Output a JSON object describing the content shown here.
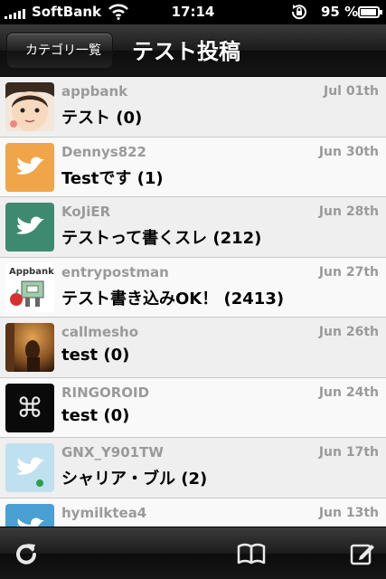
{
  "status_bar": {
    "carrier": "SoftBank",
    "time": "17:14",
    "battery_percent": "95 %"
  },
  "nav": {
    "back_label": "カテゴリ一覧",
    "title": "テスト投稿"
  },
  "posts": [
    {
      "user": "appbank",
      "date": "Jul 01th",
      "title": "テスト (0)",
      "avatar": "face-avatar"
    },
    {
      "user": "Dennys822",
      "date": "Jun 30th",
      "title": "Testです (1)",
      "avatar": "twitter-bird-orange"
    },
    {
      "user": "KoJiER",
      "date": "Jun 28th",
      "title": "テストって書くスレ (212)",
      "avatar": "twitter-bird-green"
    },
    {
      "user": "entrypostman",
      "date": "Jun 27th",
      "title": "テスト書き込みOK！ (2413)",
      "avatar": "appbank-logo"
    },
    {
      "user": "callmesho",
      "date": "Jun 26th",
      "title": "test (0)",
      "avatar": "photo-avatar"
    },
    {
      "user": "RINGOROID",
      "date": "Jun 24th",
      "title": "test (0)",
      "avatar": "command-key-avatar"
    },
    {
      "user": "GNX_Y901TW",
      "date": "Jun 17th",
      "title": "シャリア・ブル (2)",
      "avatar": "twitter-bird-lightblue"
    },
    {
      "user": "hymilktea4",
      "date": "Jun 13th",
      "title": "",
      "avatar": "twitter-bird-blue"
    }
  ],
  "colors": {
    "list_odd": "#efefef",
    "list_even": "#f9f9f9",
    "meta_text": "#9a9a9a"
  }
}
